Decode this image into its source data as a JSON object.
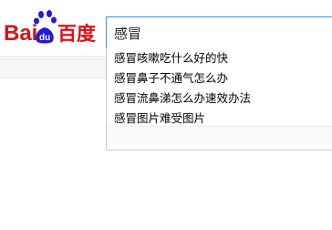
{
  "header": {
    "logo_text": "Baidu百度"
  },
  "search": {
    "value": "感冒"
  },
  "suggestions": [
    {
      "label": "感冒咳嗽吃什么好的快"
    },
    {
      "label": "感冒鼻子不通气怎么办"
    },
    {
      "label": "感冒流鼻涕怎么办速效办法"
    },
    {
      "label": "感冒图片难受图片"
    }
  ],
  "colors": {
    "brand_red": "#de0f17",
    "brand_blue": "#2319dc",
    "search_border": "#4791ff"
  },
  "icons": {
    "logo": "baidu-paw-logo"
  }
}
